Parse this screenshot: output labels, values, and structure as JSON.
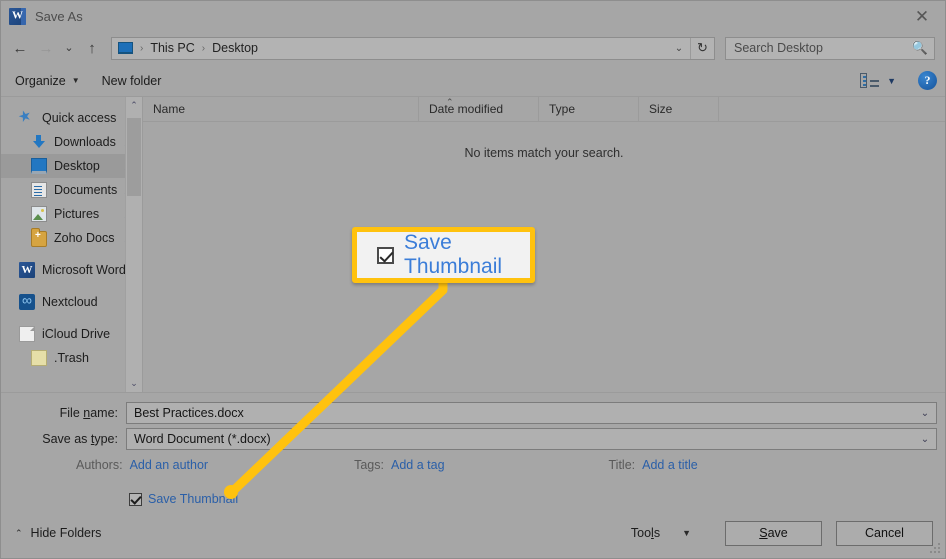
{
  "window": {
    "app_icon": "word-icon",
    "title": "Save As",
    "close_label": "✕"
  },
  "nav": {
    "back_icon": "←",
    "forward_icon": "→",
    "recent_icon": "⌄",
    "up_icon": "↑",
    "address": {
      "computer_icon": "this-pc-icon",
      "crumbs": [
        "This PC",
        "Desktop"
      ],
      "separator": "›",
      "dropdown_icon": "⌄",
      "refresh_icon": "↻"
    },
    "search": {
      "placeholder": "Search Desktop",
      "icon": "search-icon"
    }
  },
  "commandbar": {
    "organize_label": "Organize",
    "organize_caret": "▼",
    "new_folder_label": "New folder",
    "view_caret": "▼",
    "help_label": "?"
  },
  "sidebar": {
    "items": [
      {
        "label": "Quick access",
        "icon": "star-icon",
        "indent": 0,
        "pinned": false,
        "selected": false
      },
      {
        "label": "Downloads",
        "icon": "download-icon",
        "indent": 1,
        "pinned": true,
        "selected": false
      },
      {
        "label": "Desktop",
        "icon": "monitor-icon",
        "indent": 1,
        "pinned": true,
        "selected": true
      },
      {
        "label": "Documents",
        "icon": "document-icon",
        "indent": 1,
        "pinned": true,
        "selected": false
      },
      {
        "label": "Pictures",
        "icon": "picture-icon",
        "indent": 1,
        "pinned": true,
        "selected": false
      },
      {
        "label": "Zoho Docs",
        "icon": "folder-icon",
        "indent": 1,
        "pinned": true,
        "selected": false
      },
      {
        "label": "Microsoft Word",
        "icon": "word-app-icon",
        "indent": 0,
        "pinned": false,
        "selected": false
      },
      {
        "label": "Nextcloud",
        "icon": "nextcloud-icon",
        "indent": 0,
        "pinned": false,
        "selected": false
      },
      {
        "label": "iCloud Drive",
        "icon": "page-icon",
        "indent": 0,
        "pinned": false,
        "selected": false
      },
      {
        "label": ".Trash",
        "icon": "trash-icon",
        "indent": 1,
        "pinned": false,
        "selected": false
      }
    ],
    "scroll_up_icon": "⌃",
    "scroll_down_icon": "⌄"
  },
  "filelist": {
    "columns": [
      "Name",
      "Date modified",
      "Type",
      "Size"
    ],
    "sort_indicator": "⌃",
    "empty_message": "No items match your search.",
    "rows": []
  },
  "form": {
    "file_name": {
      "label_before": "File ",
      "label_accel": "n",
      "label_after": "ame:",
      "value": "Best Practices.docx",
      "dropdown_icon": "⌄"
    },
    "save_as_type": {
      "label_before": "Save as ",
      "label_accel": "t",
      "label_after": "ype:",
      "value": "Word Document (*.docx)",
      "dropdown_icon": "⌄"
    },
    "authors": {
      "label": "Authors:",
      "link": "Add an author"
    },
    "tags": {
      "label": "Tags:",
      "link": "Add a tag"
    },
    "title": {
      "label": "Title:",
      "link": "Add a title"
    },
    "save_thumbnail": {
      "label": "Save Thumbnail",
      "checked": true
    }
  },
  "bottombar": {
    "hide_folders_label": "Hide Folders",
    "hide_folders_caret": "⌃",
    "tools_before": "Too",
    "tools_accel": "l",
    "tools_after": "s",
    "tools_caret": "▼",
    "save_accel": "S",
    "save_after": "ave",
    "cancel_label": "Cancel"
  },
  "callout": {
    "label": "Save Thumbnail",
    "checked": true,
    "accent_color": "#ffc20e",
    "text_color": "#3b7dd8"
  }
}
